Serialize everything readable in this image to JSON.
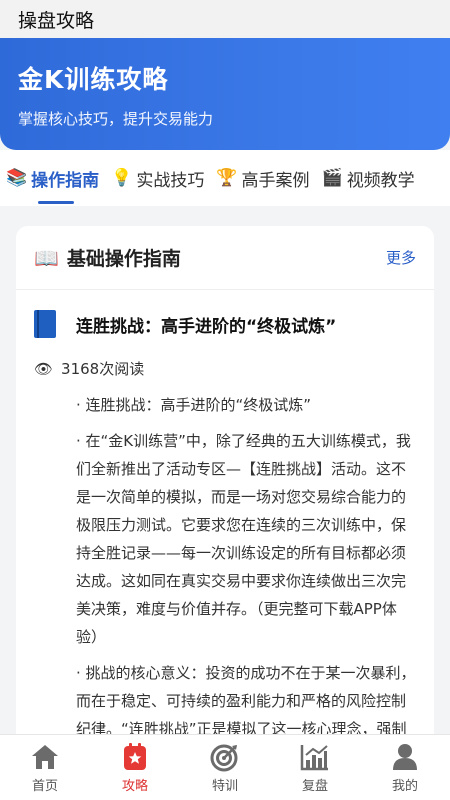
{
  "topbar": {
    "title": "操盘攻略"
  },
  "hero": {
    "title": "金K训练攻略",
    "subtitle": "掌握核心技巧，提升交易能力"
  },
  "tabs": [
    {
      "icon": "📚",
      "label": "操作指南",
      "active": true
    },
    {
      "icon": "💡",
      "label": "实战技巧",
      "active": false
    },
    {
      "icon": "🏆",
      "label": "高手案例",
      "active": false
    },
    {
      "icon": "🎬",
      "label": "视频教学",
      "active": false
    }
  ],
  "section": {
    "icon": "📖",
    "title": "基础操作指南",
    "more": "更多"
  },
  "article": {
    "title": "连胜挑战：高手进阶的“终极试炼”",
    "views": "3168次阅读",
    "paragraphs": [
      "· 连胜挑战：高手进阶的“终极试炼”",
      "· 在“金K训练营”中，除了经典的五大训练模式，我们全新推出了活动专区—【连胜挑战】活动。这不是一次简单的模拟，而是一场对您交易综合能力的极限压力测试。它要求您在连续的三次训练中，保持全胜记录——每一次训练设定的所有目标都必须达成。这如同在真实交易中要求你连续做出三次完美决策，难度与价值并存。（更完整可下载APP体验）",
      "· 挑战的核心意义：投资的成功不在于某一次暴利，而在于稳定、可持续的盈利能力和严格的风险控制纪律。“连胜挑战”正是模拟了这一核心理念，强制训练您在收益、回撤、胜率"
    ]
  },
  "nav": [
    {
      "icon": "home-icon",
      "label": "首页",
      "active": false
    },
    {
      "icon": "strategy-icon",
      "label": "攻略",
      "active": true
    },
    {
      "icon": "target-icon",
      "label": "特训",
      "active": false
    },
    {
      "icon": "chart-icon",
      "label": "复盘",
      "active": false
    },
    {
      "icon": "user-icon",
      "label": "我的",
      "active": false
    }
  ],
  "colors": {
    "accent": "#2a5fc8",
    "active_nav": "#dd3333"
  }
}
